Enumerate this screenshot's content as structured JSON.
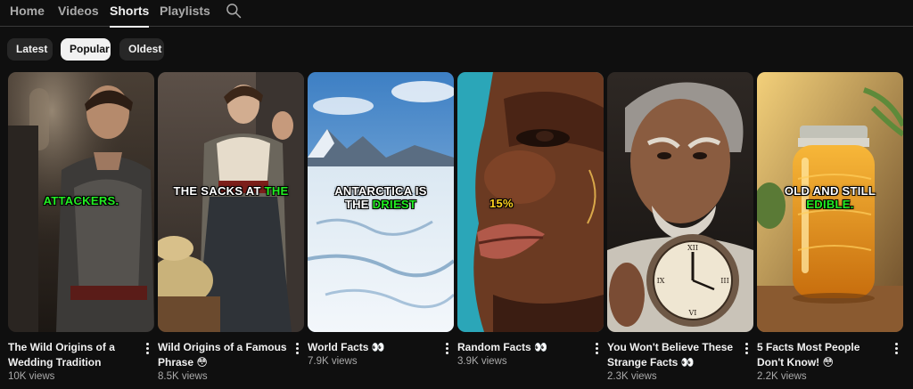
{
  "tabs": [
    {
      "label": "Home",
      "active": false
    },
    {
      "label": "Videos",
      "active": false
    },
    {
      "label": "Shorts",
      "active": true
    },
    {
      "label": "Playlists",
      "active": false
    }
  ],
  "search_icon": "search-icon",
  "filters": [
    {
      "label": "Latest",
      "active": false
    },
    {
      "label": "Popular",
      "active": true
    },
    {
      "label": "Oldest",
      "active": false
    }
  ],
  "shorts": [
    {
      "title": "The Wild Origins of a Wedding Tradition",
      "views": "10K views",
      "caption": [
        {
          "text": "ATTACKERS.",
          "color": "green"
        }
      ]
    },
    {
      "title": "Wild Origins of a Famous Phrase 😳",
      "views": "8.5K views",
      "caption": [
        {
          "text": "THE SACKS AT ",
          "color": "white"
        },
        {
          "text": "THE",
          "color": "green"
        }
      ]
    },
    {
      "title": "World Facts 👀",
      "views": "7.9K views",
      "caption": [
        {
          "text": "ANTARCTICA IS",
          "color": "white",
          "break": true
        },
        {
          "text": "THE ",
          "color": "white"
        },
        {
          "text": "DRIEST",
          "color": "green"
        }
      ]
    },
    {
      "title": "Random Facts 👀",
      "views": "3.9K views",
      "caption": [
        {
          "text": "15%",
          "color": "yellow"
        }
      ]
    },
    {
      "title": "You Won't Believe These Strange Facts 👀",
      "views": "2.3K views",
      "caption": []
    },
    {
      "title": "5 Facts Most People Don't Know! 😳",
      "views": "2.2K views",
      "caption": [
        {
          "text": "OLD AND STILL",
          "color": "white",
          "break": true
        },
        {
          "text": "EDIBLE.",
          "color": "green"
        }
      ]
    }
  ],
  "more_icon": "more-vertical-icon",
  "colors": {
    "background": "#0f0f0f",
    "chip": "#272727",
    "chip_active": "#f1f1f1",
    "text_primary": "#f1f1f1",
    "text_secondary": "#aaaaaa",
    "caption_green": "#22ee22",
    "caption_yellow": "#ffd21f"
  }
}
